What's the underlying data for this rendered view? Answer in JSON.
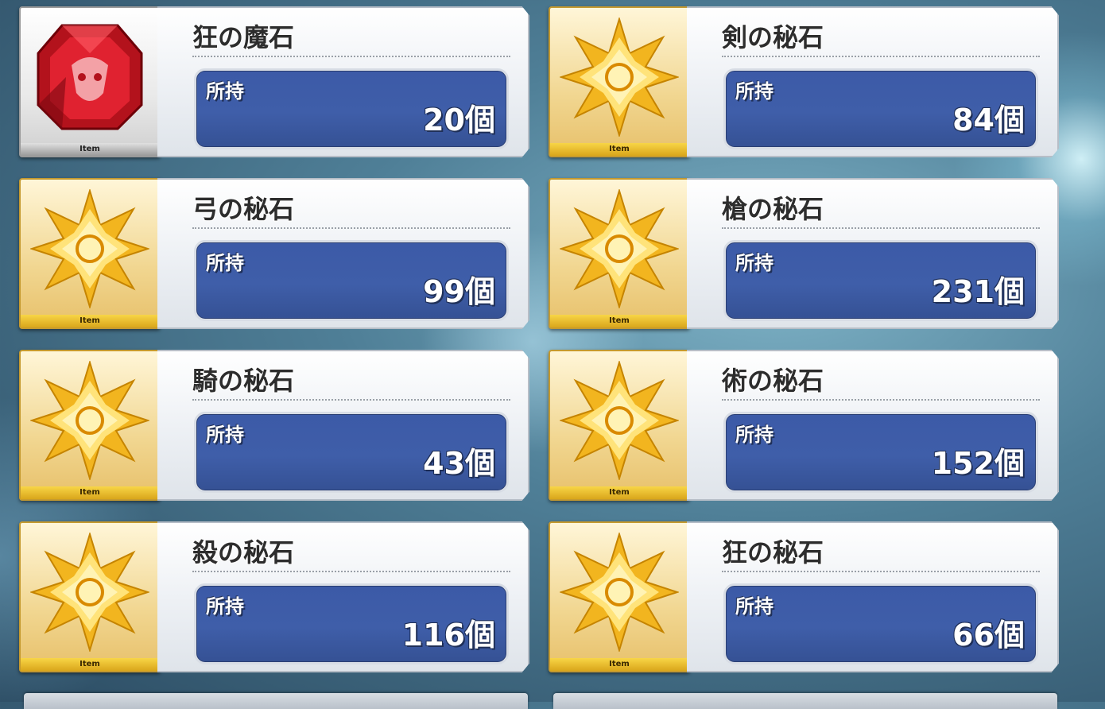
{
  "screen": {
    "owned_label": "所持",
    "unit": "個",
    "item_tag": "Item"
  },
  "items": [
    {
      "name": "狂の魔石",
      "owned": "20",
      "icon": "red-gem-berserker-icon",
      "color": "#c0101a",
      "frame": "silver"
    },
    {
      "name": "剣の秘石",
      "owned": "84",
      "icon": "gold-star-saber-icon",
      "color": "#f2b51f",
      "frame": "gold"
    },
    {
      "name": "弓の秘石",
      "owned": "99",
      "icon": "gold-star-archer-icon",
      "color": "#f2b51f",
      "frame": "gold"
    },
    {
      "name": "槍の秘石",
      "owned": "231",
      "icon": "gold-star-lancer-icon",
      "color": "#f2b51f",
      "frame": "gold"
    },
    {
      "name": "騎の秘石",
      "owned": "43",
      "icon": "gold-star-rider-icon",
      "color": "#f2b51f",
      "frame": "gold"
    },
    {
      "name": "術の秘石",
      "owned": "152",
      "icon": "gold-star-caster-icon",
      "color": "#f2b51f",
      "frame": "gold"
    },
    {
      "name": "殺の秘石",
      "owned": "116",
      "icon": "gold-star-assassin-icon",
      "color": "#f2b51f",
      "frame": "gold"
    },
    {
      "name": "狂の秘石",
      "owned": "66",
      "icon": "gold-star-berserker-icon",
      "color": "#f2b51f",
      "frame": "gold"
    }
  ]
}
